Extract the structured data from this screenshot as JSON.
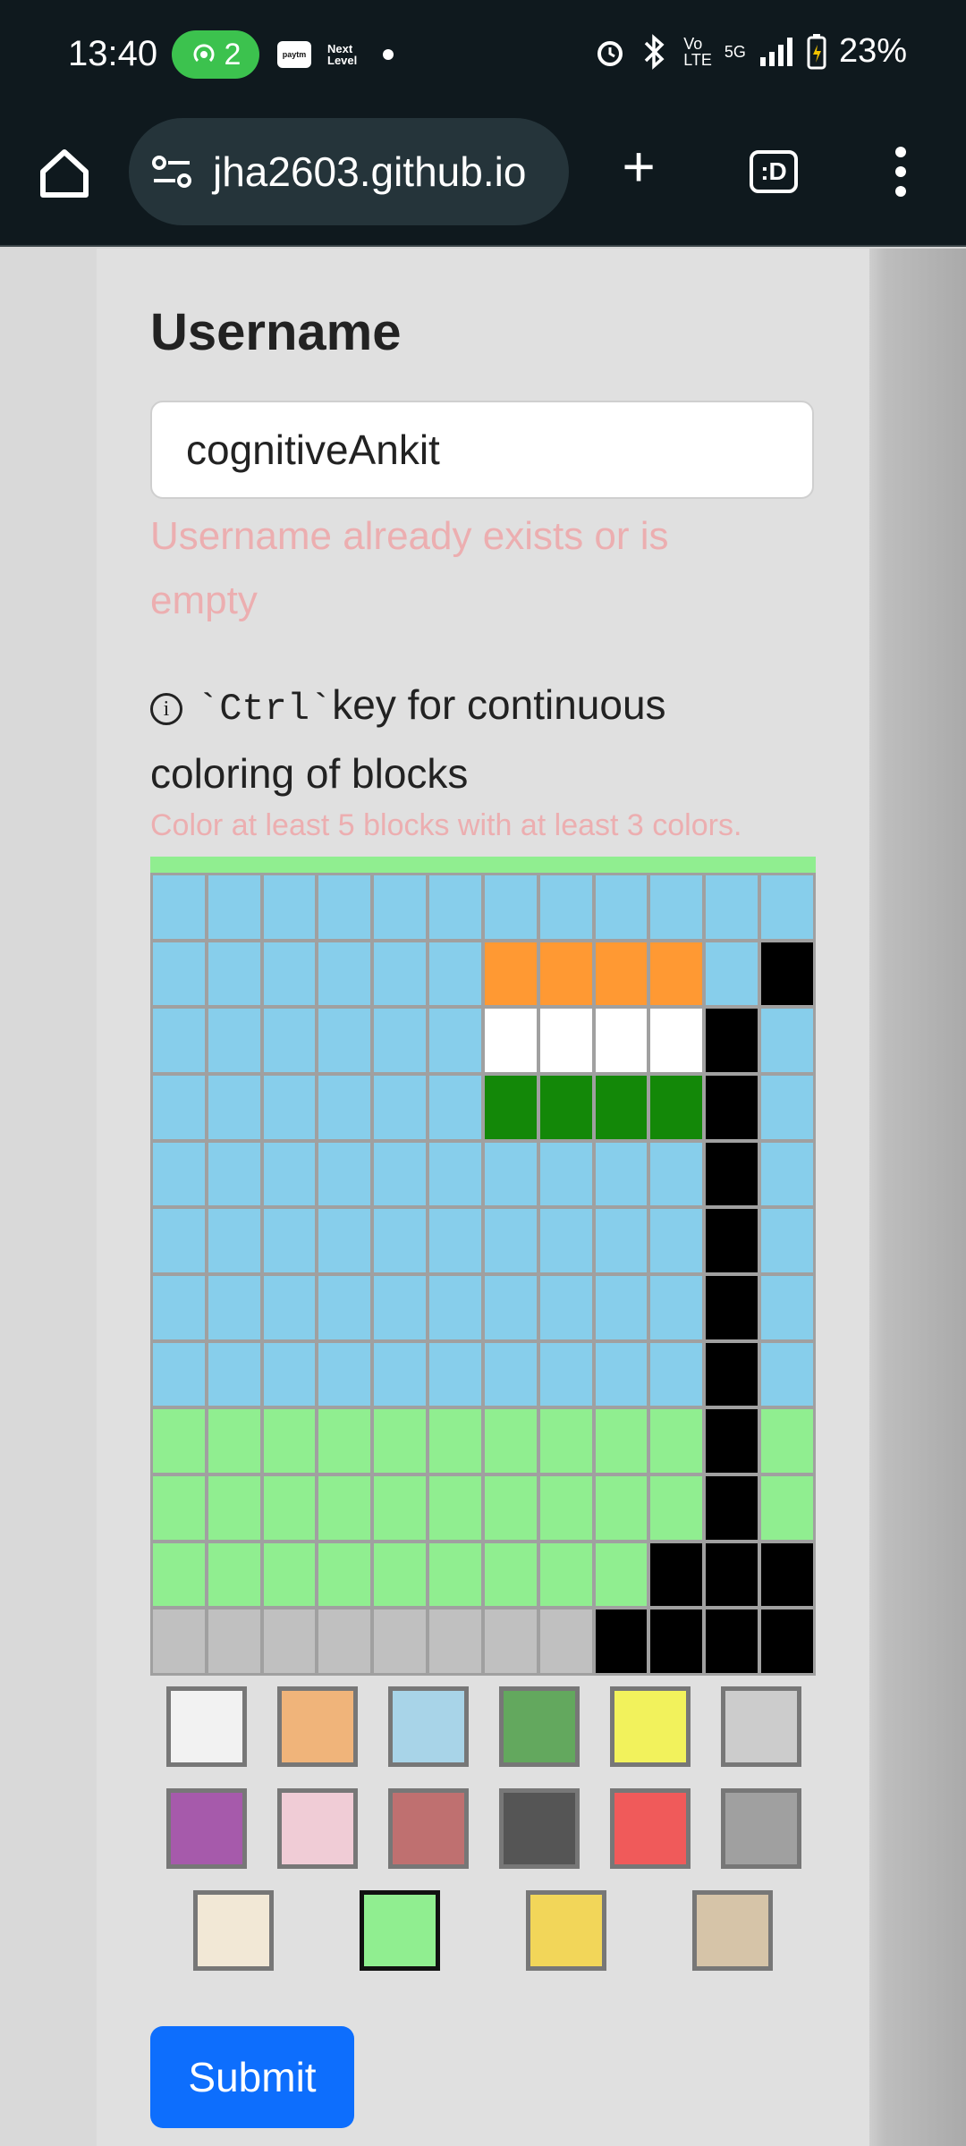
{
  "status_bar": {
    "time": "13:40",
    "hotspot_count": "2",
    "app1": "paytm",
    "app2_line1": "Next",
    "app2_line2": "Level",
    "battery": "23%",
    "net_vo": "Vo",
    "net_lte": "LTE",
    "net_5g": "5G"
  },
  "browser": {
    "url": "jha2603.github.io",
    "tab_label": ":D"
  },
  "form": {
    "username_label": "Username",
    "username_value": "cognitiveAnkit",
    "username_error": "Username already exists or is empty",
    "tip_key": "`Ctrl`",
    "tip_text": "key for continuous coloring of blocks",
    "color_error": "Color at least 5 blocks with at least 3 colors.",
    "submit_label": "Submit"
  },
  "grid": {
    "legend": {
      "s": "#87ceeb",
      "o": "#ff9933",
      "w": "#ffffff",
      "g": "#138808",
      "k": "#000000",
      "l": "#90ee90",
      "y": "#c0c0c0"
    },
    "rows": [
      "ssssssssssss",
      "ssssssoooosks",
      "sssssswwwwks",
      "ssssssggggks",
      "ssssssssssks",
      "ssssssssssks",
      "ssssssssssks",
      "ssssssssssks",
      "llllllllllkl",
      "llllllllllkl",
      "lllllllllkkk",
      "yyyyyyyykkkk"
    ]
  },
  "palette": {
    "colors": [
      "#f2f2f2",
      "#f0b47a",
      "#a8d4e8",
      "#63a85e",
      "#f2f25c",
      "#cccccc",
      "#a65aab",
      "#f0ccd6",
      "#bf7070",
      "#555555",
      "#f05a5a",
      "#a0a0a0",
      "#f2e8d6",
      "#90ee90",
      "#f2d659",
      "#d6c4a8"
    ],
    "selected_index": 13
  }
}
